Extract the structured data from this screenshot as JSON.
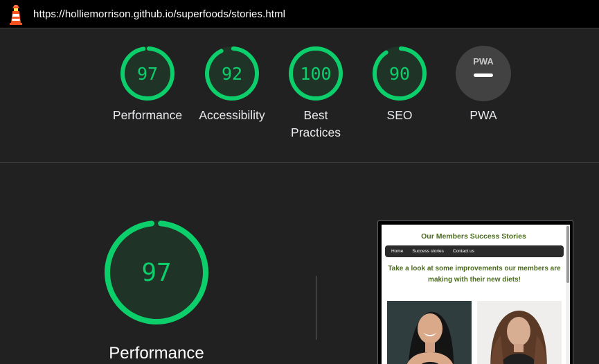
{
  "browser": {
    "url": "https://holliemorrison.github.io/superfoods/stories.html",
    "logo_icon": "lighthouse-icon"
  },
  "categories": [
    {
      "key": "performance",
      "score": "97",
      "label_lines": [
        "Performance"
      ],
      "color": "#0cce6b"
    },
    {
      "key": "accessibility",
      "score": "92",
      "label_lines": [
        "Accessibility"
      ],
      "color": "#0cce6b"
    },
    {
      "key": "best-practices",
      "score": "100",
      "label_lines": [
        "Best",
        "Practices"
      ],
      "color": "#0cce6b"
    },
    {
      "key": "seo",
      "score": "90",
      "label_lines": [
        "SEO"
      ],
      "color": "#0cce6b"
    },
    {
      "key": "pwa",
      "score": "",
      "label_lines": [
        "PWA"
      ],
      "badge_text": "PWA",
      "icon": "pwa-badge-icon",
      "color": "#424242"
    }
  ],
  "main": {
    "score": "97",
    "label": "Performance",
    "score_fraction": 0.97,
    "color": "#0cce6b"
  },
  "screenshot": {
    "title": "Our Members Success Stories",
    "nav": [
      "Home",
      "Success stories",
      "Contact us"
    ],
    "subtitle_lines": [
      "Take a look at some improvements our members are",
      "making with their new diets!"
    ],
    "accent": "#4a6b1c"
  }
}
